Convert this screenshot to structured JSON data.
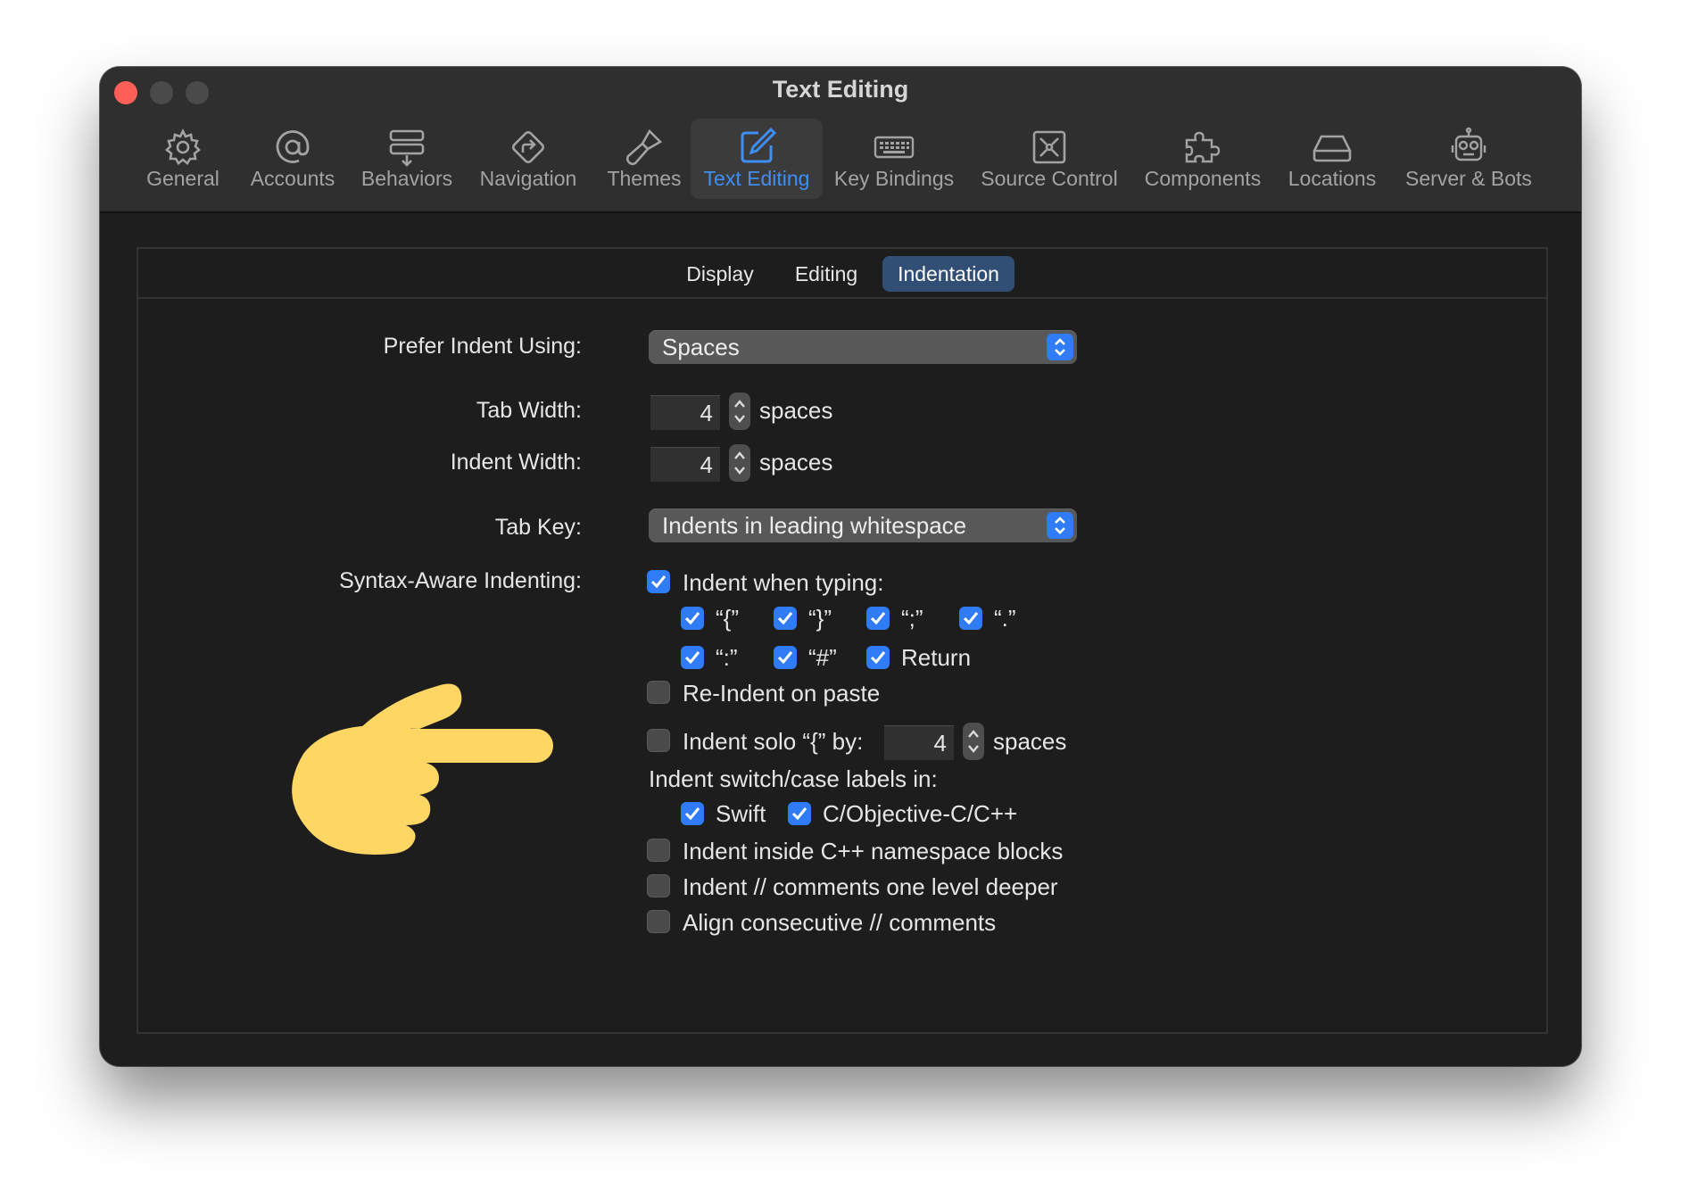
{
  "window": {
    "title": "Text Editing"
  },
  "toolbar": {
    "items": [
      {
        "label": "General",
        "icon": "gear-icon"
      },
      {
        "label": "Accounts",
        "icon": "at-sign-icon"
      },
      {
        "label": "Behaviors",
        "icon": "behaviors-icon"
      },
      {
        "label": "Navigation",
        "icon": "navigation-icon"
      },
      {
        "label": "Themes",
        "icon": "brush-icon"
      },
      {
        "label": "Text Editing",
        "icon": "edit-icon",
        "active": true
      },
      {
        "label": "Key Bindings",
        "icon": "keyboard-icon"
      },
      {
        "label": "Source Control",
        "icon": "source-control-icon"
      },
      {
        "label": "Components",
        "icon": "puzzle-icon"
      },
      {
        "label": "Locations",
        "icon": "drive-icon"
      },
      {
        "label": "Server & Bots",
        "icon": "robot-icon"
      }
    ],
    "accent": "#3f8ef4"
  },
  "tabs": {
    "items": [
      "Display",
      "Editing",
      "Indentation"
    ],
    "selected": "Indentation"
  },
  "form": {
    "prefer_indent": {
      "label": "Prefer Indent Using:",
      "value": "Spaces"
    },
    "tab_width": {
      "label": "Tab Width:",
      "value": "4",
      "unit": "spaces"
    },
    "indent_width": {
      "label": "Indent Width:",
      "value": "4",
      "unit": "spaces"
    },
    "tab_key": {
      "label": "Tab Key:",
      "value": "Indents in leading whitespace"
    },
    "syntax_aware": {
      "label": "Syntax-Aware Indenting:",
      "indent_when_typing": {
        "label": "Indent when typing:",
        "checked": true
      },
      "chars": [
        {
          "label": "“{”",
          "checked": true
        },
        {
          "label": "“}”",
          "checked": true
        },
        {
          "label": "“;”",
          "checked": true
        },
        {
          "label": "“.”",
          "checked": true
        },
        {
          "label": "“:”",
          "checked": true
        },
        {
          "label": "“#”",
          "checked": true
        },
        {
          "label": "Return",
          "checked": true
        }
      ],
      "reindent_paste": {
        "label": "Re-Indent on paste",
        "checked": false
      },
      "indent_solo": {
        "label": "Indent solo “{” by:",
        "checked": false,
        "value": "4",
        "unit": "spaces"
      },
      "switch_case": {
        "label": "Indent switch/case labels in:",
        "swift": {
          "label": "Swift",
          "checked": true
        },
        "objc": {
          "label": "C/Objective-C/C++",
          "checked": true
        }
      },
      "cpp_namespace": {
        "label": "Indent inside C++ namespace blocks",
        "checked": false
      },
      "comments_deeper": {
        "label": "Indent // comments one level deeper",
        "checked": false
      },
      "align_comments": {
        "label": "Align consecutive // comments",
        "checked": false
      }
    }
  },
  "colors": {
    "checkbox_on": "#2f7cf6",
    "tab_selected": "#314e75",
    "hand": "#fdd663"
  }
}
